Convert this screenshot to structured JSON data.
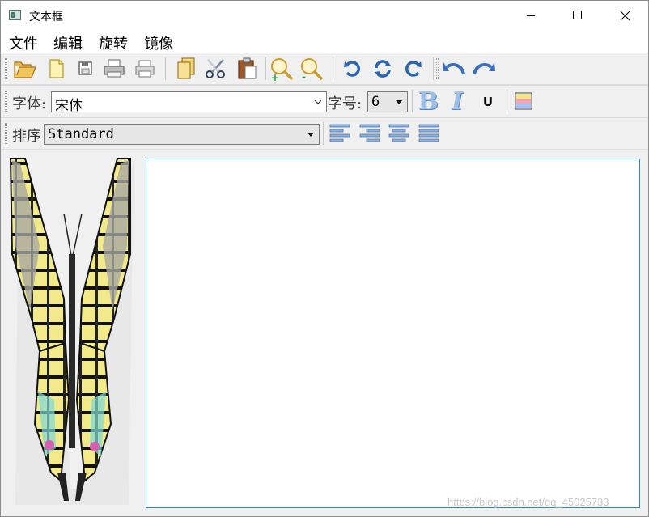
{
  "window": {
    "title": "文本框"
  },
  "menu": {
    "items": [
      "文件",
      "编辑",
      "旋转",
      "镜像"
    ]
  },
  "font_toolbar": {
    "font_label": "字体:",
    "font_value": "宋体",
    "size_label": "字号:",
    "size_value": "6",
    "bold_label": "B",
    "italic_label": "I",
    "underline_label": "U"
  },
  "sort_toolbar": {
    "sort_label": "排序",
    "sort_value": "Standard"
  },
  "watermark": "https://blog.csdn.net/qq_45025733",
  "colors": {
    "text_border": "#2a8ab8",
    "accent": "#2f7fc8"
  }
}
